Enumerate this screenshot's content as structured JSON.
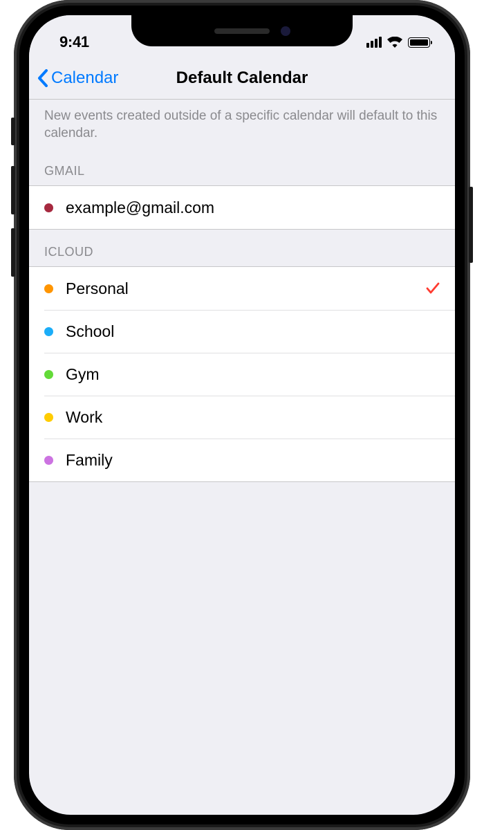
{
  "status_bar": {
    "time": "9:41"
  },
  "nav": {
    "back_label": "Calendar",
    "title": "Default Calendar"
  },
  "description": "New events created outside of a specific calendar will default to this calendar.",
  "sections": [
    {
      "header": "GMAIL",
      "items": [
        {
          "label": "example@gmail.com",
          "color": "#a6293f",
          "selected": false
        }
      ]
    },
    {
      "header": "ICLOUD",
      "items": [
        {
          "label": "Personal",
          "color": "#ff9500",
          "selected": true
        },
        {
          "label": "School",
          "color": "#1badf8",
          "selected": false
        },
        {
          "label": "Gym",
          "color": "#63da38",
          "selected": false
        },
        {
          "label": "Work",
          "color": "#ffcc00",
          "selected": false
        },
        {
          "label": "Family",
          "color": "#cc73e1",
          "selected": false
        }
      ]
    }
  ]
}
